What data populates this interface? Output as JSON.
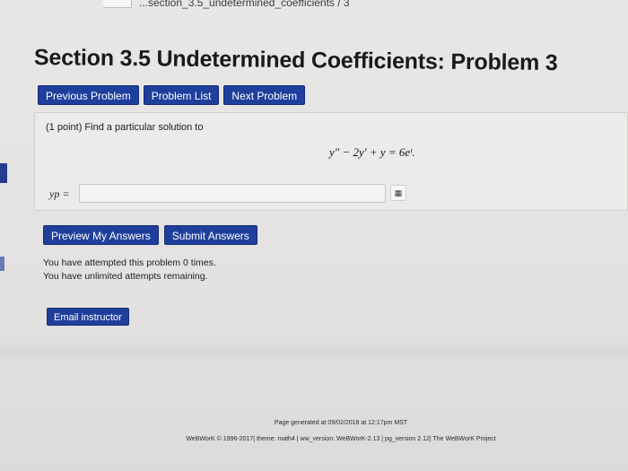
{
  "breadcrumb": {
    "text": "...section_3.5_undetermined_coefficients / 3"
  },
  "header": {
    "title": "Section 3.5 Undetermined Coefficients: Problem 3"
  },
  "nav": {
    "previous": "Previous Problem",
    "list": "Problem List",
    "next": "Next Problem"
  },
  "problem": {
    "statement": "(1 point) Find a particular solution to",
    "equation": "y″ − 2y′ + y = 6eᵗ.",
    "answer_label": "yp =",
    "answer_value": "",
    "equation_editor_icon": "grid-icon"
  },
  "actions": {
    "preview": "Preview My Answers",
    "submit": "Submit Answers"
  },
  "status": {
    "attempts": "You have attempted this problem 0 times.",
    "remaining": "You have unlimited attempts remaining."
  },
  "email": {
    "label": "Email instructor"
  },
  "footer": {
    "generated": "Page generated at 09/02/2018 at 12:17pm MST",
    "credits": "WeBWorK © 1996-2017| theme: math4 | ww_version: WeBWorK-2.13 | pg_version 2.12| The WeBWorK Project"
  },
  "colors": {
    "button": "#1f3f9c",
    "background": "#e6e4e3"
  }
}
